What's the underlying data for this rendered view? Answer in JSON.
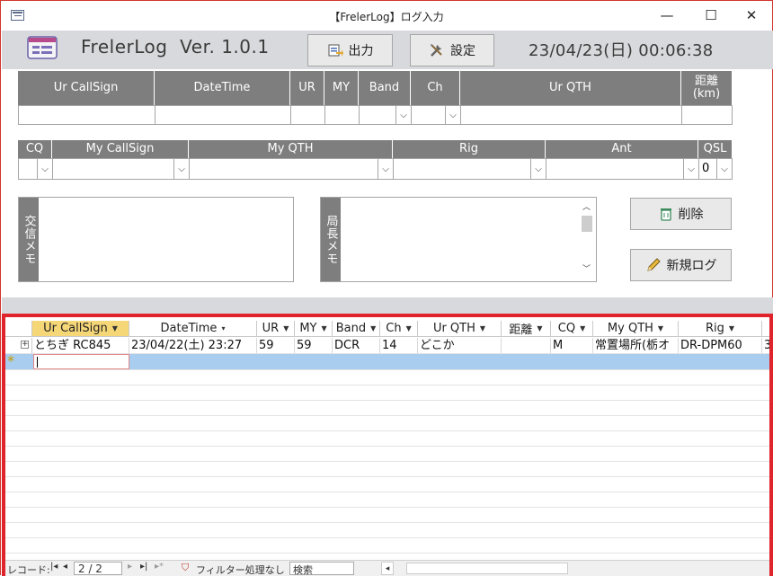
{
  "window": {
    "title": "【FrelerLog】ログ入力",
    "min": "—",
    "max": "☐",
    "close": "✕"
  },
  "header": {
    "app_name": "FrelerLog  Ver. 1.0.1",
    "output_label": "出力",
    "settings_label": "設定",
    "clock": "23/04/23(日) 00:06:38"
  },
  "form_row1": {
    "headers": [
      "Ur CallSign",
      "DateTime",
      "UR",
      "MY",
      "Band",
      "Ch",
      "Ur QTH",
      "距離\n(km)"
    ]
  },
  "form_row2": {
    "headers": [
      "CQ",
      "My CallSign",
      "My QTH",
      "Rig",
      "Ant",
      "QSL"
    ],
    "qsl_value": "0"
  },
  "memo": {
    "contact_memo_label": "交信メモ",
    "operator_memo_label": "局長メモ"
  },
  "actions": {
    "delete_label": "削除",
    "new_log_label": "新規ログ"
  },
  "datasheet": {
    "columns": [
      "Ur CallSign",
      "DateTime",
      "UR",
      "MY",
      "Band",
      "Ch",
      "Ur QTH",
      "距離",
      "CQ",
      "My QTH",
      "Rig"
    ],
    "rows": [
      [
        "とちぎ RC845",
        "23/04/22(土) 23:27",
        "59",
        "59",
        "DCR",
        "14",
        "どこか",
        "",
        "M",
        "常置場所(栃オ",
        "DR-DPM60"
      ]
    ],
    "overflow_cell": "3",
    "new_row_marker": "*"
  },
  "statusbar": {
    "record_label": "レコード:",
    "record_position": "2 / 2",
    "filter_label": "フィルター処理なし",
    "search_label": "検索"
  }
}
